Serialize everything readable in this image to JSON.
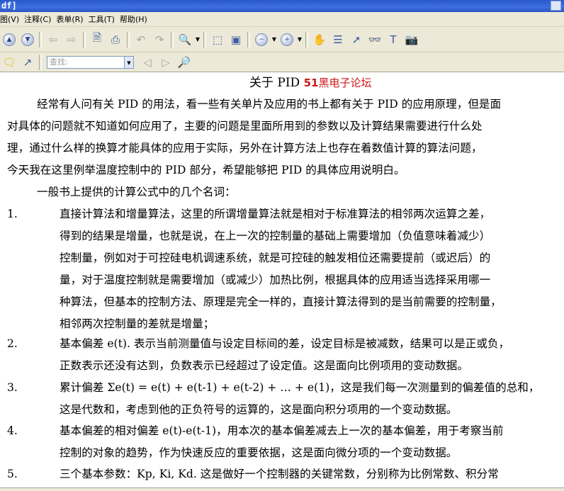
{
  "window": {
    "title_fragment": "df]"
  },
  "menu": [
    {
      "label": "图(V)"
    },
    {
      "label": "注释(C)"
    },
    {
      "label": "表单(R)"
    },
    {
      "label": "工具(T)"
    },
    {
      "label": "帮助(H)"
    }
  ],
  "toolbar": {
    "find_placeholder": "查找:"
  },
  "document": {
    "title": "关于 PID",
    "watermark_number": "51",
    "watermark_text": "黑电子论坛",
    "intro": [
      "经常有人问有关 PID 的用法，看一些有关单片及应用的书上都有关于 PID 的应用原理，但是面",
      "对具体的问题就不知道如何应用了，主要的问题是里面所用到的参数以及计算结果需要进行什么处",
      "理，通过什么样的换算才能具体的应用于实际，另外在计算方法上也存在着数值计算的算法问题，",
      "今天我在这里例举温度控制中的 PID 部分，希望能够把 PID 的具体应用说明白。"
    ],
    "lead": "一般书上提供的计算公式中的几个名词：",
    "items": [
      {
        "num": "1.",
        "lines": [
          "直接计算法和增量算法，这里的所谓增量算法就是相对于标准算法的相邻两次运算之差，",
          "得到的结果是增量，也就是说，在上一次的控制量的基础上需要增加（负值意味着减少）",
          "控制量，例如对于可控硅电机调速系统，就是可控硅的触发相位还需要提前（或迟后）的",
          "量，对于温度控制就是需要增加（或减少）加热比例，根据具体的应用适当选择采用哪一",
          "种算法，但基本的控制方法、原理是完全一样的，直接计算法得到的是当前需要的控制量，",
          "相邻两次控制量的差就是增量；"
        ]
      },
      {
        "num": "2.",
        "lines": [
          "基本偏差 e(t). 表示当前测量值与设定目标间的差，设定目标是被减数，结果可以是正或负，",
          "正数表示还没有达到，负数表示已经超过了设定值。这是面向比例项用的变动数据。"
        ]
      },
      {
        "num": "3.",
        "lines": [
          "累计偏差 Σe(t) = e(t) + e(t-1) + e(t-2) + … + e(1)，这是我们每一次测量到的偏差值的总和，",
          "这是代数和，考虑到他的正负符号的运算的，这是面向积分项用的一个变动数据。"
        ]
      },
      {
        "num": "4.",
        "lines": [
          "基本偏差的相对偏差  e(t)-e(t-1)，用本次的基本偏差减去上一次的基本偏差，用于考察当前",
          "控制的对象的趋势，作为快速反应的重要依据，这是面向微分项的一个变动数据。"
        ]
      },
      {
        "num": "5.",
        "lines": [
          "三个基本参数：Kp, Ki, Kd.  这是做好一个控制器的关键常数，分别称为比例常数、积分常"
        ]
      }
    ]
  }
}
